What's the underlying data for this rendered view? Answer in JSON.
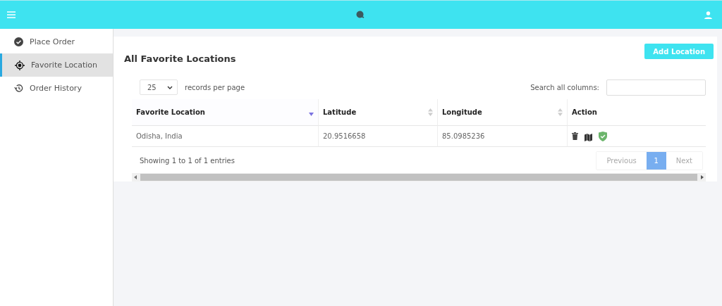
{
  "sidebar": {
    "items": [
      {
        "label": "Place Order",
        "selected": false
      },
      {
        "label": "Favorite Location",
        "selected": true
      },
      {
        "label": "Order History",
        "selected": false
      }
    ]
  },
  "page": {
    "title": "All Favorite Locations",
    "add_button": "Add Location"
  },
  "table_controls": {
    "page_size": "25",
    "page_size_label": "records per page",
    "search_label": "Search all columns:"
  },
  "table": {
    "columns": [
      {
        "label": "Favorite Location",
        "kind": "sortable",
        "sorted": true
      },
      {
        "label": "Latitude",
        "kind": "sortable",
        "sorted": false
      },
      {
        "label": "Longitude",
        "kind": "sortable",
        "sorted": false
      },
      {
        "label": "Action",
        "kind": "plain"
      }
    ],
    "rows": [
      {
        "cells": [
          "Odisha, India",
          "20.9516658",
          "85.0985236"
        ]
      }
    ]
  },
  "footer": {
    "info": "Showing 1 to 1 of 1 entries",
    "pages": [
      {
        "label": "Previous",
        "kind": "nav",
        "disabled": true,
        "selected": false
      },
      {
        "label": "1",
        "kind": "page",
        "disabled": false,
        "selected": true
      },
      {
        "label": "Next",
        "kind": "nav",
        "disabled": true,
        "selected": false
      }
    ]
  }
}
